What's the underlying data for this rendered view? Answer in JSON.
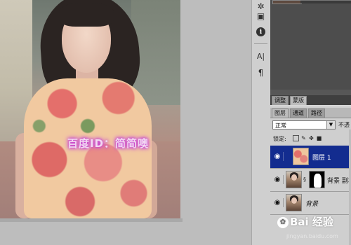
{
  "canvas": {
    "watermark_text": "百度ID：简简噢"
  },
  "tools": [
    {
      "name": "stamp-icon",
      "glyph": "✲"
    },
    {
      "name": "image-icon",
      "glyph": "▣"
    },
    {
      "name": "info-icon",
      "glyph": "i"
    },
    {
      "name": "text-tool-icon",
      "glyph": "A|"
    },
    {
      "name": "paragraph-icon",
      "glyph": "¶"
    }
  ],
  "adjust_panel": {
    "tabs": [
      "调整",
      "蒙版"
    ]
  },
  "layers_panel": {
    "tabs": [
      "图层",
      "通道",
      "路径"
    ],
    "blend_mode": "正常",
    "opacity_label": "不透",
    "lock_label": "锁定:",
    "layers": [
      {
        "name": "图层 1",
        "selected": true,
        "thumb": "floral"
      },
      {
        "name": "背景 副本",
        "selected": false,
        "thumb": "photo",
        "has_mask": true
      },
      {
        "name": "背景",
        "selected": false,
        "thumb": "photo",
        "italic": true
      }
    ]
  },
  "footer": {
    "brand": "Bai 经验",
    "url": "jingyan.baidu.com"
  }
}
